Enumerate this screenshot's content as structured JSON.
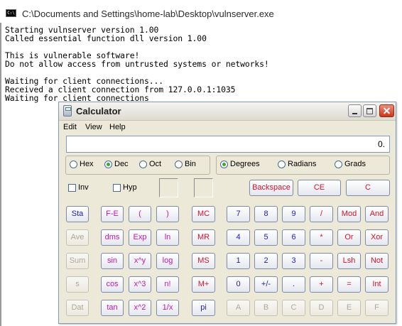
{
  "console": {
    "title": "C:\\Documents and Settings\\home-lab\\Desktop\\vulnserver.exe",
    "icon": "console-icon",
    "lines": [
      "Starting vulnserver version 1.00",
      "Called essential function dll version 1.00",
      "",
      "This is vulnerable software!",
      "Do not allow access from untrusted systems or networks!",
      "",
      "Waiting for client connections...",
      "Received a client connection from 127.0.0.1:1035",
      "Waiting for client connections"
    ]
  },
  "calculator": {
    "title": "Calculator",
    "menu": {
      "edit": "Edit",
      "view": "View",
      "help": "Help"
    },
    "display": "0.",
    "base_modes": [
      "Hex",
      "Dec",
      "Oct",
      "Bin"
    ],
    "base_selected": "Dec",
    "angle_modes": [
      "Degrees",
      "Radians",
      "Grads"
    ],
    "angle_selected": "Degrees",
    "inv": "Inv",
    "hyp": "Hyp",
    "edit_buttons": [
      "Backspace",
      "CE",
      "C"
    ],
    "col1": [
      "Sta",
      "Ave",
      "Sum",
      "s",
      "Dat"
    ],
    "col2": [
      "F-E",
      "dms",
      "sin",
      "cos",
      "tan"
    ],
    "col3": [
      "(",
      "Exp",
      "x^y",
      "x^3",
      "x^2"
    ],
    "col4": [
      ")",
      "ln",
      "log",
      "n!",
      "1/x"
    ],
    "memory": [
      "MC",
      "MR",
      "MS",
      "M+",
      "pi"
    ],
    "keypad": [
      [
        "7",
        "8",
        "9",
        "/",
        "Mod",
        "And"
      ],
      [
        "4",
        "5",
        "6",
        "*",
        "Or",
        "Xor"
      ],
      [
        "1",
        "2",
        "3",
        "-",
        "Lsh",
        "Not"
      ],
      [
        "0",
        "+/-",
        ".",
        "+",
        "=",
        "Int"
      ],
      [
        "A",
        "B",
        "C",
        "D",
        "E",
        "F"
      ]
    ]
  },
  "colors": {
    "digit": "#1c1cb4",
    "operator": "#d8102c",
    "function": "#c415b5",
    "disabled": "#aca899"
  }
}
